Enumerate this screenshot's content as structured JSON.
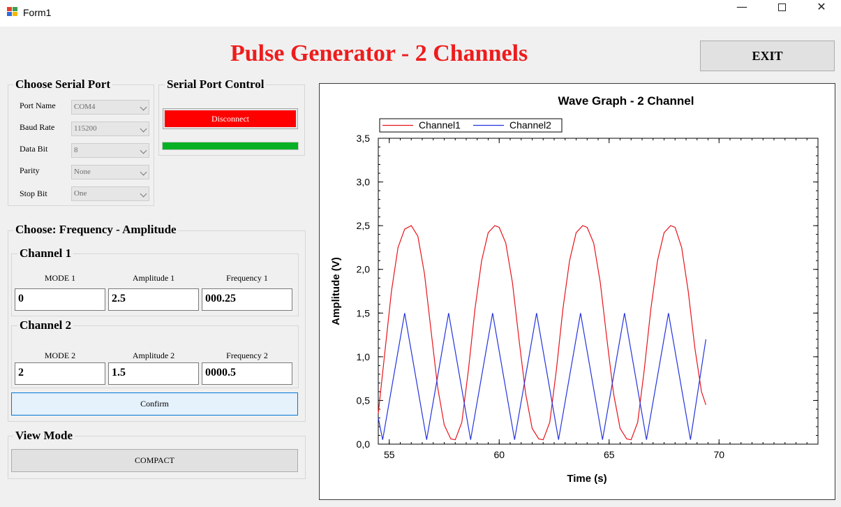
{
  "window": {
    "title": "Form1",
    "minimize": "—",
    "close": "✕"
  },
  "header": {
    "title": "Pulse Generator - 2 Channels",
    "exit_label": "EXIT",
    "title_color": "#ee1c1c"
  },
  "serial_port": {
    "title": "Choose Serial Port",
    "fields": [
      {
        "label": "Port Name",
        "value": "COM4"
      },
      {
        "label": "Baud Rate",
        "value": "115200"
      },
      {
        "label": "Data Bit",
        "value": "8"
      },
      {
        "label": "Parity",
        "value": "None"
      },
      {
        "label": "Stop Bit",
        "value": "One"
      }
    ]
  },
  "serial_control": {
    "title": "Serial Port Control",
    "disconnect_label": "Disconnect",
    "progress": 1.0,
    "progress_color": "#07b025"
  },
  "freq_amp": {
    "title": "Choose: Frequency - Amplitude",
    "channel1": {
      "title": "Channel 1",
      "mode_label": "MODE 1",
      "amp_label": "Amplitude 1",
      "freq_label": "Frequency 1",
      "mode": "0",
      "amp": "2.5",
      "freq": "000.25"
    },
    "channel2": {
      "title": "Channel 2",
      "mode_label": "MODE 2",
      "amp_label": "Amplitude 2",
      "freq_label": "Frequency 2",
      "mode": "2",
      "amp": "1.5",
      "freq": "0000.5"
    },
    "confirm_label": "Confirm"
  },
  "view_mode": {
    "title": "View Mode",
    "compact_label": "COMPACT"
  },
  "chart_data": {
    "type": "line",
    "title": "Wave Graph - 2 Channel",
    "xlabel": "Time (s)",
    "ylabel": "Amplitude (V)",
    "xlim": [
      54.5,
      74.5
    ],
    "ylim": [
      0,
      3.5
    ],
    "x_ticks": [
      55,
      60,
      65,
      70
    ],
    "x_tick_labels": [
      "55",
      "60",
      "65",
      "70"
    ],
    "y_ticks": [
      0,
      0.5,
      1,
      1.5,
      2,
      2.5,
      3,
      3.5
    ],
    "y_tick_labels": [
      "0,0",
      "0,5",
      "1,0",
      "1,5",
      "2,0",
      "2,5",
      "3,0",
      "3,5"
    ],
    "legend_position": "top-left",
    "series": [
      {
        "name": "Channel1",
        "color": "#e8141b",
        "x": [
          54.5,
          54.8,
          55.1,
          55.4,
          55.7,
          56.0,
          56.3,
          56.6,
          56.9,
          57.2,
          57.5,
          57.8,
          58.0,
          58.3,
          58.6,
          58.9,
          59.2,
          59.5,
          59.8,
          60.0,
          60.3,
          60.6,
          60.9,
          61.2,
          61.5,
          61.8,
          62.0,
          62.3,
          62.6,
          62.9,
          63.2,
          63.5,
          63.8,
          64.0,
          64.3,
          64.6,
          64.9,
          65.2,
          65.5,
          65.8,
          66.0,
          66.3,
          66.6,
          66.9,
          67.2,
          67.5,
          67.8,
          68.0,
          68.3,
          68.6,
          68.9,
          69.2,
          69.4
        ],
        "y": [
          0.35,
          1.05,
          1.75,
          2.25,
          2.46,
          2.5,
          2.38,
          1.95,
          1.3,
          0.65,
          0.22,
          0.06,
          0.05,
          0.25,
          0.85,
          1.55,
          2.1,
          2.42,
          2.5,
          2.48,
          2.3,
          1.85,
          1.2,
          0.58,
          0.18,
          0.06,
          0.05,
          0.25,
          0.85,
          1.55,
          2.1,
          2.42,
          2.5,
          2.48,
          2.3,
          1.85,
          1.2,
          0.58,
          0.18,
          0.06,
          0.05,
          0.25,
          0.85,
          1.55,
          2.1,
          2.42,
          2.5,
          2.48,
          2.25,
          1.75,
          1.1,
          0.6,
          0.45
        ]
      },
      {
        "name": "Channel2",
        "color": "#2233dd",
        "x": [
          54.5,
          54.7,
          55.7,
          56.7,
          57.7,
          58.7,
          59.7,
          60.7,
          61.7,
          62.7,
          63.7,
          64.7,
          65.7,
          66.7,
          67.7,
          68.7,
          69.4
        ],
        "y": [
          0.3,
          0.05,
          1.5,
          0.05,
          1.5,
          0.05,
          1.5,
          0.05,
          1.5,
          0.05,
          1.5,
          0.05,
          1.5,
          0.05,
          1.5,
          0.05,
          1.2
        ]
      }
    ]
  }
}
